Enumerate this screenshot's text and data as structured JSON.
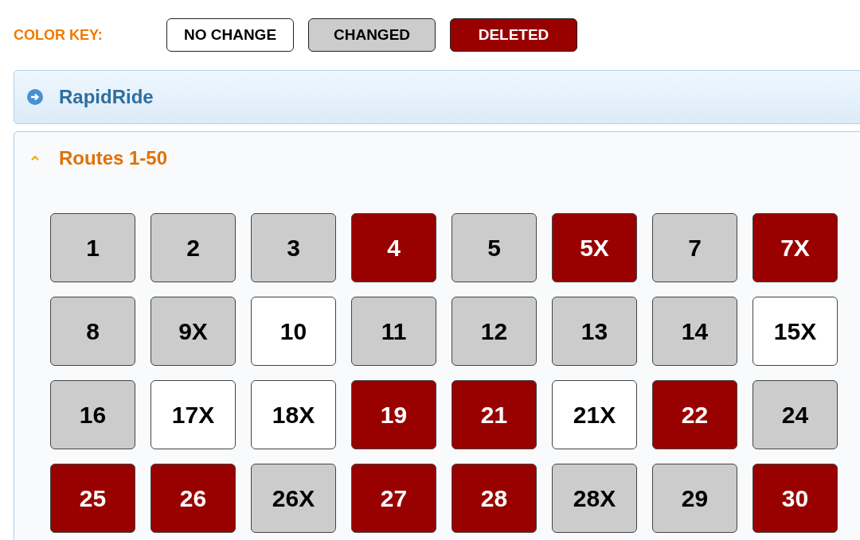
{
  "color_key": {
    "label": "COLOR KEY:",
    "items": [
      {
        "label": "NO CHANGE",
        "color": "#ffffff"
      },
      {
        "label": "CHANGED",
        "color": "#cccccc"
      },
      {
        "label": "DELETED",
        "color": "#990000"
      }
    ]
  },
  "sections": [
    {
      "title": "RapidRide",
      "expanded": false
    },
    {
      "title": "Routes 1-50",
      "expanded": true,
      "routes": [
        {
          "label": "1",
          "color": "#cccccc"
        },
        {
          "label": "2",
          "color": "#cccccc"
        },
        {
          "label": "3",
          "color": "#cccccc"
        },
        {
          "label": "4",
          "color": "#990000"
        },
        {
          "label": "5",
          "color": "#cccccc"
        },
        {
          "label": "5X",
          "color": "#990000"
        },
        {
          "label": "7",
          "color": "#cccccc"
        },
        {
          "label": "7X",
          "color": "#990000"
        },
        {
          "label": "8",
          "color": "#cccccc"
        },
        {
          "label": "9X",
          "color": "#cccccc"
        },
        {
          "label": "10",
          "color": "#ffffff"
        },
        {
          "label": "11",
          "color": "#cccccc"
        },
        {
          "label": "12",
          "color": "#cccccc"
        },
        {
          "label": "13",
          "color": "#cccccc"
        },
        {
          "label": "14",
          "color": "#cccccc"
        },
        {
          "label": "15X",
          "color": "#ffffff"
        },
        {
          "label": "16",
          "color": "#cccccc"
        },
        {
          "label": "17X",
          "color": "#ffffff"
        },
        {
          "label": "18X",
          "color": "#ffffff"
        },
        {
          "label": "19",
          "color": "#990000"
        },
        {
          "label": "21",
          "color": "#990000"
        },
        {
          "label": "21X",
          "color": "#ffffff"
        },
        {
          "label": "22",
          "color": "#990000"
        },
        {
          "label": "24",
          "color": "#cccccc"
        },
        {
          "label": "25",
          "color": "#990000"
        },
        {
          "label": "26",
          "color": "#990000"
        },
        {
          "label": "26X",
          "color": "#cccccc"
        },
        {
          "label": "27",
          "color": "#990000"
        },
        {
          "label": "28",
          "color": "#990000"
        },
        {
          "label": "28X",
          "color": "#cccccc"
        },
        {
          "label": "29",
          "color": "#cccccc"
        },
        {
          "label": "30",
          "color": "#990000"
        }
      ]
    }
  ]
}
